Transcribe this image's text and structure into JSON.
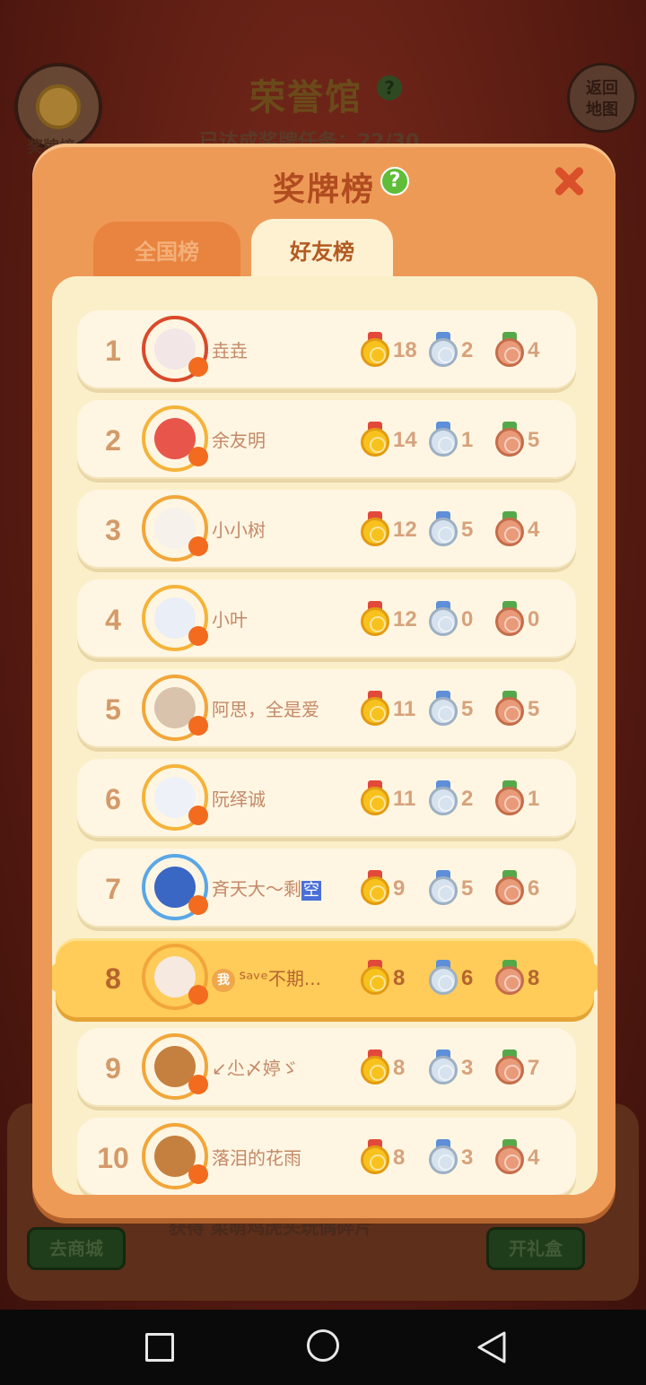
{
  "background": {
    "badge_label": "奖牌榜",
    "title": "荣誉馆",
    "help": "?",
    "progress": "已达成奖牌任务：22/30",
    "back_line1": "返回",
    "back_line2": "地图",
    "shop_button": "去商城",
    "hint": "获得 柔萌鸡虎头玩偶碎片",
    "gift_button": "开礼盒"
  },
  "modal": {
    "title": "奖牌榜",
    "help": "?",
    "tabs": [
      {
        "label": "全国榜",
        "active": false
      },
      {
        "label": "好友榜",
        "active": true
      }
    ],
    "me_tag": "我"
  },
  "leaderboard": [
    {
      "rank": "1",
      "name": "垚垚",
      "gold": "18",
      "silver": "2",
      "bronze": "4",
      "frame": "#d94a2a",
      "face": "#f3e6e6"
    },
    {
      "rank": "2",
      "name": "余友明",
      "gold": "14",
      "silver": "1",
      "bronze": "5",
      "frame": "#f5b33a",
      "face": "#e8554a"
    },
    {
      "rank": "3",
      "name": "小小树",
      "gold": "12",
      "silver": "5",
      "bronze": "4",
      "frame": "#f2a63a",
      "face": "#f6f1ea"
    },
    {
      "rank": "4",
      "name": "小叶",
      "gold": "12",
      "silver": "0",
      "bronze": "0",
      "frame": "#f5b33a",
      "face": "#e9eef7"
    },
    {
      "rank": "5",
      "name": "阿思，全是爱",
      "gold": "11",
      "silver": "5",
      "bronze": "5",
      "frame": "#f2a63a",
      "face": "#d9c3ad"
    },
    {
      "rank": "6",
      "name": "阮绎诚",
      "gold": "11",
      "silver": "2",
      "bronze": "1",
      "frame": "#f5b33a",
      "face": "#eef2f8"
    },
    {
      "rank": "7",
      "name": "斉天大～剩",
      "name_tag": "空",
      "gold": "9",
      "silver": "5",
      "bronze": "6",
      "frame": "#5aa7e6",
      "face": "#3a66c4"
    },
    {
      "rank": "8",
      "name": "ᔆᵃᵛᵉ不期...",
      "gold": "8",
      "silver": "6",
      "bronze": "8",
      "frame": "#f2a63a",
      "face": "#f6e9e0",
      "is_me": true
    },
    {
      "rank": "9",
      "name": "↙尐〆婷ゞ",
      "gold": "8",
      "silver": "3",
      "bronze": "7",
      "frame": "#f2a63a",
      "face": "#c5803f"
    },
    {
      "rank": "10",
      "name": "落泪的花雨",
      "gold": "8",
      "silver": "3",
      "bronze": "4",
      "frame": "#f2a63a",
      "face": "#c5803f"
    }
  ],
  "colors": {
    "modal_bg": "#ee9a57",
    "panel_bg": "#fbefc9",
    "row_bg": "#fef6e2",
    "me_row_bg": "#ffcb59",
    "title_color": "#b04c20",
    "rank_color": "#d39a6a"
  },
  "icons": {
    "close": "close-icon",
    "help": "help-icon",
    "gold_medal": "gold-medal-icon",
    "silver_medal": "silver-medal-icon",
    "bronze_medal": "bronze-medal-icon",
    "nav_recents": "square-icon",
    "nav_home": "circle-icon",
    "nav_back": "triangle-back-icon"
  }
}
